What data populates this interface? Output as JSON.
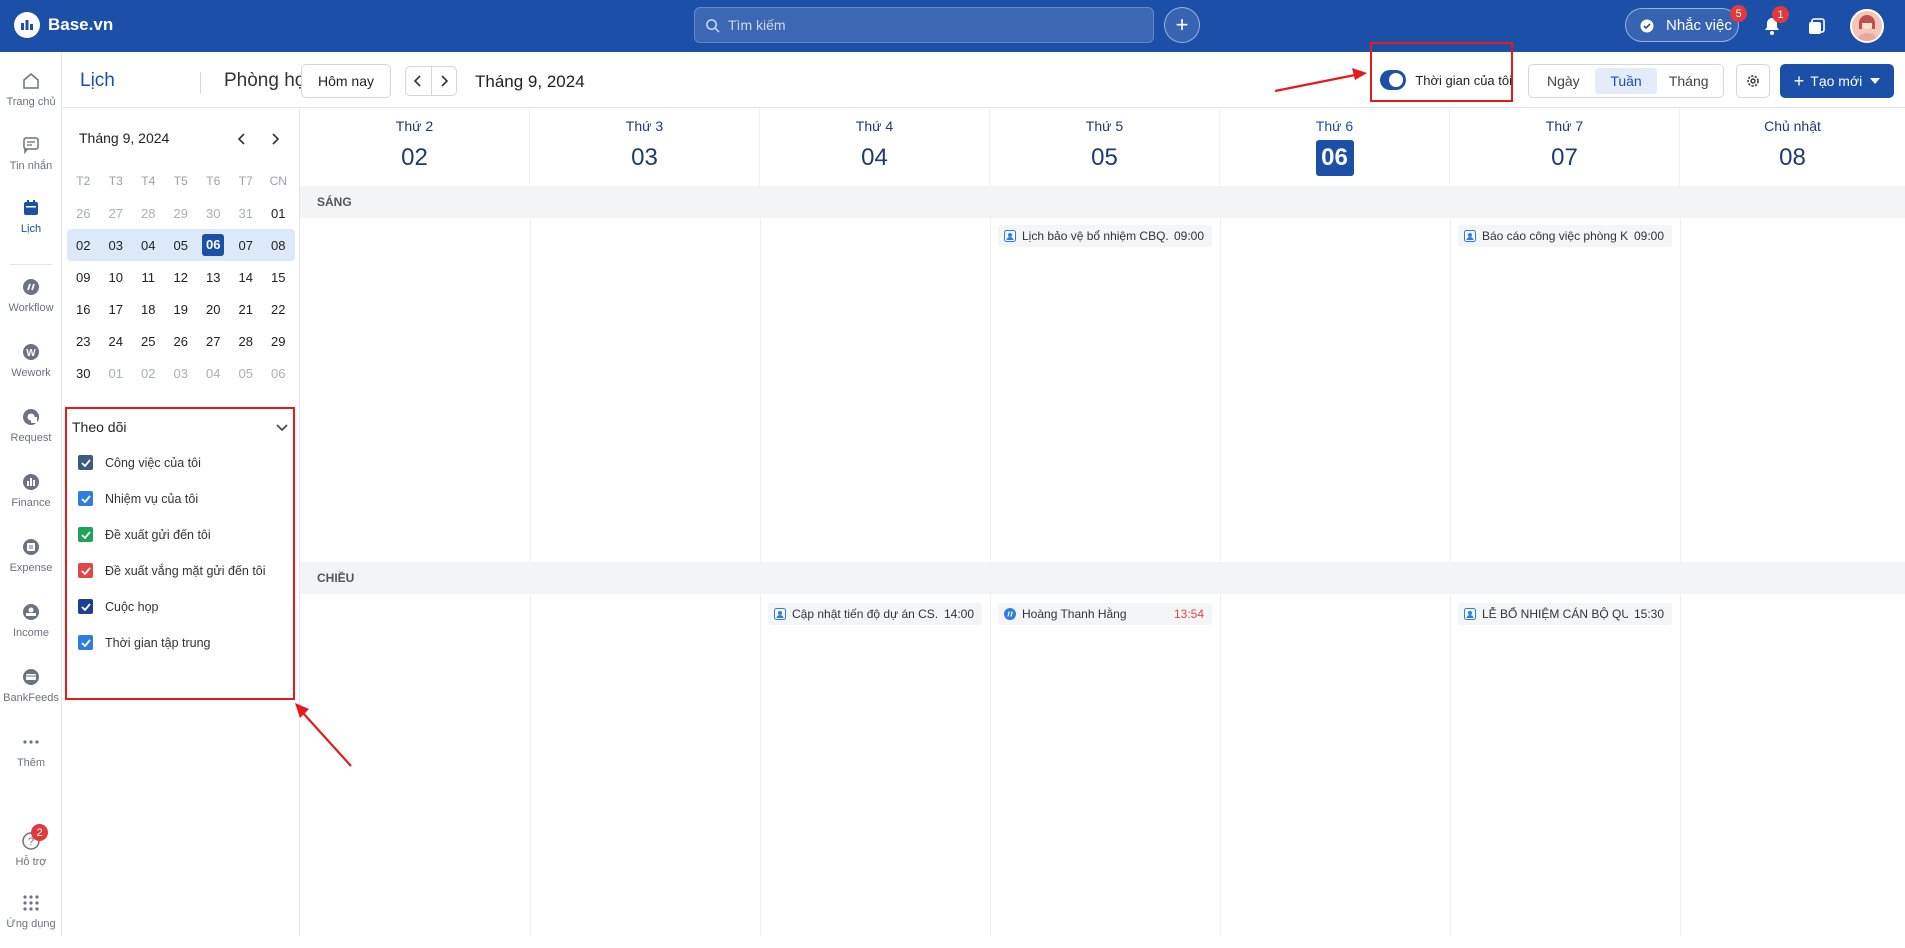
{
  "topbar": {
    "brand": "Base.vn",
    "search_placeholder": "Tìm kiếm",
    "remind_label": "Nhắc việc",
    "remind_badge": "5",
    "notif_badge": "1"
  },
  "leftnav": {
    "items": [
      {
        "label": "Trang chủ",
        "icon": "home-icon"
      },
      {
        "label": "Tin nhắn",
        "icon": "message-icon"
      },
      {
        "label": "Lịch",
        "icon": "calendar-icon"
      },
      {
        "label": "Workflow",
        "icon": "workflow-icon"
      },
      {
        "label": "Wework",
        "icon": "wework-icon"
      },
      {
        "label": "Request",
        "icon": "request-icon"
      },
      {
        "label": "Finance",
        "icon": "finance-icon"
      },
      {
        "label": "Expense",
        "icon": "expense-icon"
      },
      {
        "label": "Income",
        "icon": "income-icon"
      },
      {
        "label": "BankFeeds",
        "icon": "bankfeeds-icon"
      },
      {
        "label": "Thêm",
        "icon": "more-icon"
      },
      {
        "label": "Hỗ trợ",
        "icon": "help-icon",
        "badge": "2"
      },
      {
        "label": "Ứng dụng",
        "icon": "apps-grid-icon"
      }
    ]
  },
  "subheader": {
    "tab_calendar": "Lịch",
    "tab_rooms": "Phòng họp",
    "today_btn": "Hôm nay",
    "month_title": "Tháng 9, 2024",
    "my_time_label": "Thời gian của tôi",
    "views": [
      "Ngày",
      "Tuần",
      "Tháng"
    ],
    "selected_view": "Tuần",
    "create_label": "Tạo mới"
  },
  "mini_calendar": {
    "title": "Tháng 9, 2024",
    "dow": [
      "T2",
      "T3",
      "T4",
      "T5",
      "T6",
      "T7",
      "CN"
    ],
    "weeks": [
      [
        "26",
        "27",
        "28",
        "29",
        "30",
        "31",
        "01"
      ],
      [
        "02",
        "03",
        "04",
        "05",
        "06",
        "07",
        "08"
      ],
      [
        "09",
        "10",
        "11",
        "12",
        "13",
        "14",
        "15"
      ],
      [
        "16",
        "17",
        "18",
        "19",
        "20",
        "21",
        "22"
      ],
      [
        "23",
        "24",
        "25",
        "26",
        "27",
        "28",
        "29"
      ],
      [
        "30",
        "01",
        "02",
        "03",
        "04",
        "05",
        "06"
      ]
    ],
    "today": "06"
  },
  "follow": {
    "title": "Theo dõi",
    "items": [
      {
        "label": "Công việc của tôi",
        "color": "#3d5a80"
      },
      {
        "label": "Nhiệm vụ của tôi",
        "color": "#2f7de1"
      },
      {
        "label": "Đề xuất gửi đến tôi",
        "color": "#20a357"
      },
      {
        "label": "Đề xuất vắng mặt gửi đến tôi",
        "color": "#e04848"
      },
      {
        "label": "Cuộc họp",
        "color": "#1c3f8f"
      },
      {
        "label": "Thời gian tập trung",
        "color": "#2f7de1"
      }
    ]
  },
  "week": {
    "days": [
      {
        "name": "Thứ 2",
        "date": "02"
      },
      {
        "name": "Thứ 3",
        "date": "03"
      },
      {
        "name": "Thứ 4",
        "date": "04"
      },
      {
        "name": "Thứ 5",
        "date": "05"
      },
      {
        "name": "Thứ 6",
        "date": "06",
        "today": true
      },
      {
        "name": "Thứ 7",
        "date": "07"
      },
      {
        "name": "Chủ nhật",
        "date": "08"
      }
    ],
    "morning_label": "SÁNG",
    "afternoon_label": "CHIỀU",
    "events": [
      {
        "title": "Lịch bảo vệ bổ nhiệm CBQ...",
        "time": "09:00",
        "day": "Thứ 5",
        "section": "SÁNG",
        "icon": "meeting-icon"
      },
      {
        "title": "Báo cáo công việc phòng K...",
        "time": "09:00",
        "day": "Thứ 7",
        "section": "SÁNG",
        "icon": "meeting-icon"
      },
      {
        "title": "Cập nhật tiến độ dự án CS...",
        "time": "14:00",
        "day": "Thứ 4",
        "section": "CHIỀU",
        "icon": "meeting-icon"
      },
      {
        "title": "Hoàng Thanh Hằng",
        "time": "13:54",
        "day": "Thứ 5",
        "section": "CHIỀU",
        "icon": "workflow-icon",
        "time_color": "#e04848"
      },
      {
        "title": "LỄ BỔ NHIỆM CÁN BỘ QU...",
        "time": "15:30",
        "day": "Thứ 7",
        "section": "CHIỀU",
        "icon": "meeting-icon"
      }
    ]
  },
  "colors": {
    "primary": "#1c4fa8",
    "annotation_red": "#e61a1a"
  }
}
